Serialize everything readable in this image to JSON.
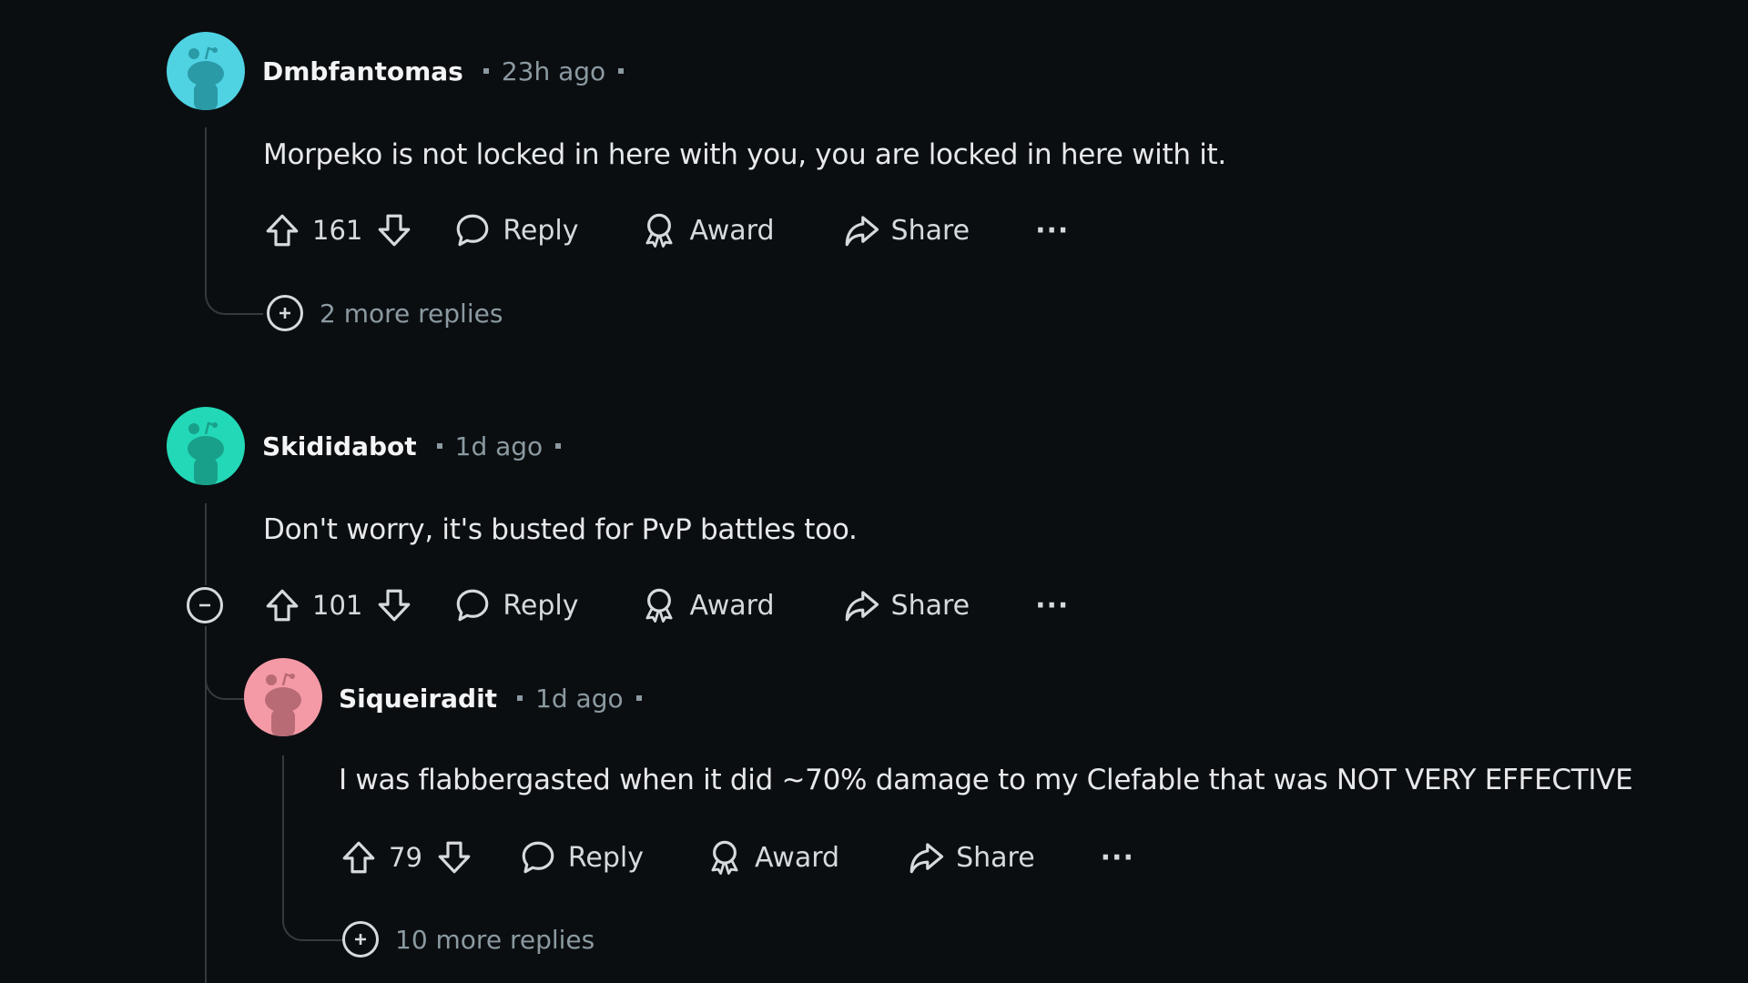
{
  "colors": {
    "background": "#0b0e11",
    "avatar_cyan": "#4fd3e3",
    "avatar_teal": "#23d8b6",
    "avatar_pink": "#f49aa6"
  },
  "comments": [
    {
      "username": "Dmbfantomas",
      "time": "23h ago",
      "avatar_color": "cyan",
      "body": "Morpeko is not locked in here with you, you are locked in here with it.",
      "score": "161",
      "actions": {
        "reply": "Reply",
        "award": "Award",
        "share": "Share",
        "more": "···"
      },
      "more_replies": "2 more replies"
    },
    {
      "username": "Skididabot",
      "time": "1d ago",
      "avatar_color": "teal",
      "body": "Don't worry, it's busted for PvP battles too.",
      "score": "101",
      "actions": {
        "reply": "Reply",
        "award": "Award",
        "share": "Share",
        "more": "···"
      },
      "replies": [
        {
          "username": "Siqueiradit",
          "time": "1d ago",
          "avatar_color": "pink",
          "body": "I was flabbergasted when it did ~70% damage to my Clefable that was NOT VERY EFFECTIVE",
          "score": "79",
          "actions": {
            "reply": "Reply",
            "award": "Award",
            "share": "Share",
            "more": "···"
          },
          "more_replies": "10 more replies"
        }
      ]
    }
  ]
}
